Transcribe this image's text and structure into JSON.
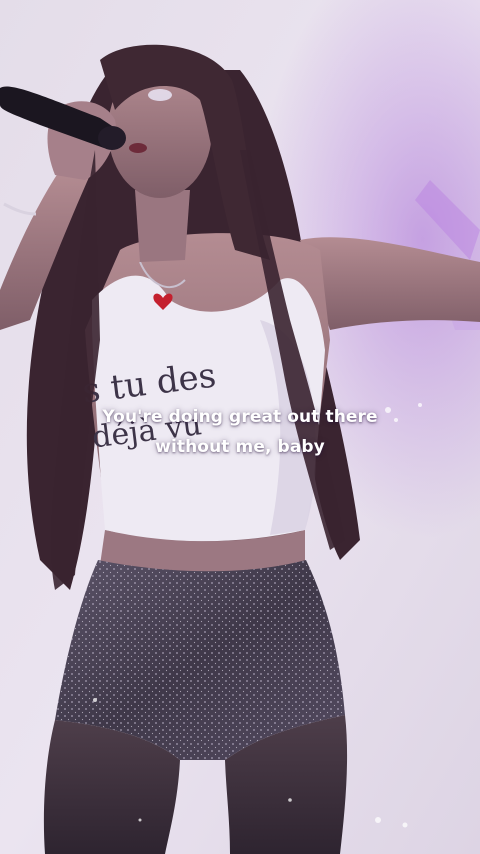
{
  "video": {
    "scene": "concert-performance",
    "palette": {
      "background": "#e9e2ee",
      "stage_light": "#b58ad8",
      "skin": "#a97f86",
      "hair": "#3a2430",
      "top": "#eeeaf3",
      "shorts": "#4b4357",
      "microphone": "#1b1620"
    },
    "caption": {
      "line1": "You're doing great out there",
      "line2": "without me, baby"
    },
    "shirt_print": {
      "line1": "s tu des",
      "line2": "déjà vu"
    }
  }
}
